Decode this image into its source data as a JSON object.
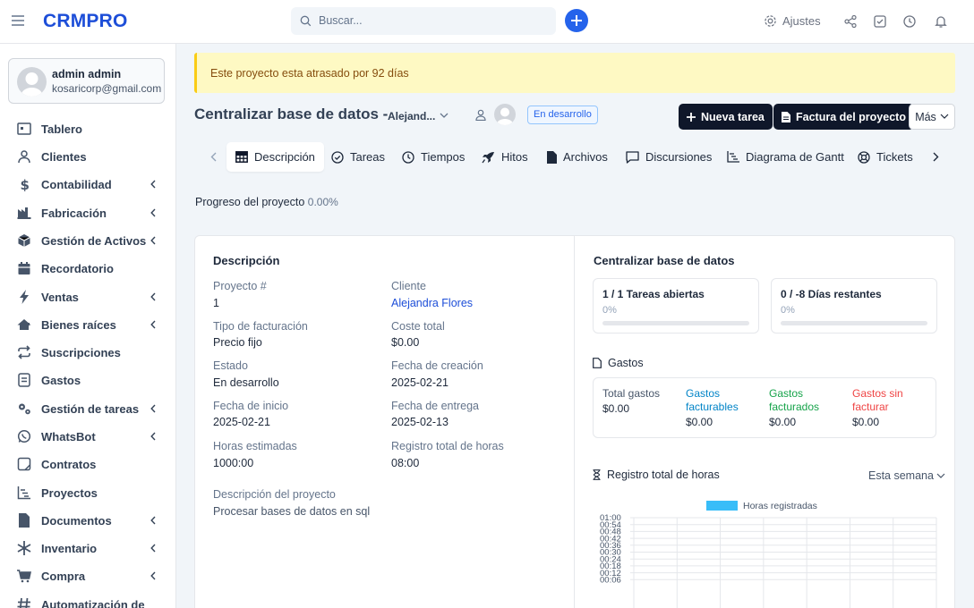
{
  "app": {
    "brand": "CRMPRO"
  },
  "header": {
    "search_placeholder": "Buscar...",
    "settings_label": "Ajustes"
  },
  "user": {
    "name": "admin admin",
    "email": "kosaricorp@gmail.com"
  },
  "sidebar": {
    "items": [
      {
        "label": "Tablero",
        "icon": "dashboard-icon",
        "expandable": false
      },
      {
        "label": "Clientes",
        "icon": "user-icon",
        "expandable": false
      },
      {
        "label": "Contabilidad",
        "icon": "dollar-icon",
        "expandable": true
      },
      {
        "label": "Fabricación",
        "icon": "factory-icon",
        "expandable": true
      },
      {
        "label": "Gestión de Activos",
        "icon": "cube-icon",
        "expandable": true
      },
      {
        "label": "Recordatorio",
        "icon": "calendar-icon",
        "expandable": false
      },
      {
        "label": "Ventas",
        "icon": "bolt-icon",
        "expandable": true
      },
      {
        "label": "Bienes raíces",
        "icon": "house-icon",
        "expandable": true
      },
      {
        "label": "Suscripciones",
        "icon": "repeat-icon",
        "expandable": false
      },
      {
        "label": "Gastos",
        "icon": "receipt-icon",
        "expandable": false
      },
      {
        "label": "Gestión de tareas",
        "icon": "cogs-icon",
        "expandable": true
      },
      {
        "label": "WhatsBot",
        "icon": "whatsapp-icon",
        "expandable": true
      },
      {
        "label": "Contratos",
        "icon": "contract-icon",
        "expandable": false
      },
      {
        "label": "Proyectos",
        "icon": "chart-line-icon",
        "expandable": false
      },
      {
        "label": "Documentos",
        "icon": "file-icon",
        "expandable": true
      },
      {
        "label": "Inventario",
        "icon": "snowflake-icon",
        "expandable": true
      },
      {
        "label": "Compra",
        "icon": "cart-icon",
        "expandable": true
      },
      {
        "label": "Automatización de",
        "icon": "hashtag-icon",
        "expandable": false
      }
    ]
  },
  "alert": {
    "text": "Este proyecto esta atrasado por 92 días"
  },
  "project": {
    "title": "Centralizar base de datos - ",
    "client_short": "Alejand...",
    "status": "En desarrollo",
    "new_task_label": "Nueva tarea",
    "invoice_label": "Factura del proyecto",
    "more_label": "Más"
  },
  "tabs": [
    {
      "label": "Descripción",
      "icon": "table-icon",
      "active": true
    },
    {
      "label": "Tareas",
      "icon": "check-circle-icon",
      "active": false
    },
    {
      "label": "Tiempos",
      "icon": "clock-icon",
      "active": false
    },
    {
      "label": "Hitos",
      "icon": "rocket-icon",
      "active": false
    },
    {
      "label": "Archivos",
      "icon": "file-icon",
      "active": false
    },
    {
      "label": "Discursiones",
      "icon": "chat-icon",
      "active": false
    },
    {
      "label": "Diagrama de Gantt",
      "icon": "gantt-icon",
      "active": false
    },
    {
      "label": "Tickets",
      "icon": "lifebuoy-icon",
      "active": false
    }
  ],
  "progress": {
    "label": "Progreso del proyecto",
    "value": "0.00%",
    "percent": 0
  },
  "details": {
    "title": "Descripción",
    "fields": [
      {
        "label": "Proyecto #",
        "value": "1"
      },
      {
        "label": "Cliente",
        "value": "Alejandra Flores"
      },
      {
        "label": "Tipo de facturación",
        "value": "Precio fijo"
      },
      {
        "label": "Coste total",
        "value": "$0.00"
      },
      {
        "label": "Estado",
        "value": "En desarrollo"
      },
      {
        "label": "Fecha de creación",
        "value": "2025-02-21"
      },
      {
        "label": "Fecha de inicio",
        "value": "2025-02-21"
      },
      {
        "label": "Fecha de entrega",
        "value": "2025-02-13"
      },
      {
        "label": "Horas estimadas",
        "value": "1000:00"
      },
      {
        "label": "Registro total de horas",
        "value": "08:00"
      }
    ],
    "desc_label": "Descripción del proyecto",
    "desc_value": "Procesar bases de datos en sql"
  },
  "overview": {
    "title": "Centralizar base de datos",
    "open_tasks": {
      "label": "1 / 1 Tareas abiertas",
      "percent_label": "0%",
      "percent": 0
    },
    "days_left": {
      "label": "0 / -8 Días restantes",
      "percent_label": "0%",
      "percent": 0
    },
    "expenses_title": "Gastos",
    "expenses": [
      {
        "label": "Total gastos",
        "value": "$0.00",
        "color": "#475569"
      },
      {
        "label": "Gastos facturables",
        "value": "$0.00",
        "color": "#0284c7"
      },
      {
        "label": "Gastos facturados",
        "value": "$0.00",
        "color": "#16a34a"
      },
      {
        "label": "Gastos sin facturar",
        "value": "$0.00",
        "color": "#ef4444"
      }
    ],
    "hours_title": "Registro total de horas",
    "period": "Esta semana"
  },
  "chart_data": {
    "type": "bar",
    "series": [
      {
        "name": "Horas registradas",
        "values": [],
        "color": "#38bdf8"
      }
    ],
    "y_ticks": [
      "01:00",
      "00:54",
      "00:48",
      "00:42",
      "00:36",
      "00:30",
      "00:24",
      "00:18",
      "00:12",
      "00:06"
    ],
    "grid": true,
    "legend": "top"
  },
  "colors": {
    "accent": "#2563eb",
    "brand": "#1d4ed8",
    "dark_button": "#0f172a",
    "alert_bg": "#fef9c3"
  }
}
